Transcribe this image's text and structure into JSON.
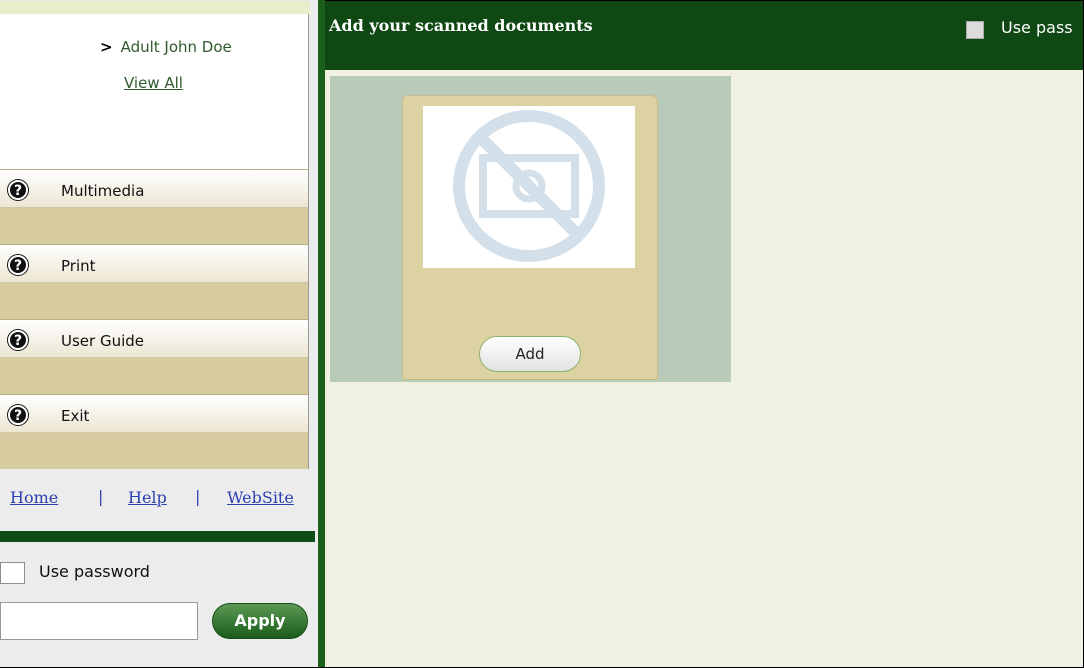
{
  "sidebar": {
    "user": {
      "chevron": ">",
      "label": "Adult  John Doe"
    },
    "view_all": "View All",
    "menu": [
      {
        "label": "Multimedia",
        "icon": "help-icon"
      },
      {
        "label": "Print",
        "icon": "help-icon"
      },
      {
        "label": "User Guide",
        "icon": "help-icon"
      },
      {
        "label": "Exit",
        "icon": "help-icon"
      }
    ],
    "help_glyph": "?",
    "links": {
      "home": "Home",
      "help": "Help",
      "website": "WebSite",
      "separator": "|"
    },
    "password": {
      "label": "Use password",
      "value": "",
      "apply": "Apply"
    }
  },
  "main": {
    "title": "Add your scanned documents",
    "password_label": "Use pass",
    "add_button": "Add",
    "placeholder_icon": "no-image-icon"
  },
  "colors": {
    "header_green": "#0f4812",
    "accent_green": "#1c5f1a",
    "card_tan": "#ddd3a2",
    "link_blue": "#2a3fb0"
  }
}
